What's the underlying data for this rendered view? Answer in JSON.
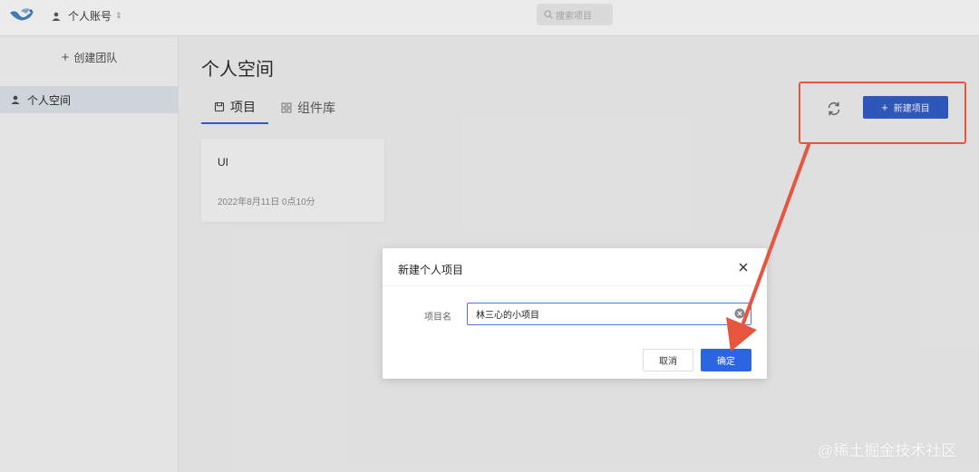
{
  "topbar": {
    "logo_icon": "bird-logo-icon",
    "account_label": "个人账号",
    "search_placeholder": "搜索项目"
  },
  "sidebar": {
    "create_team_label": "创建团队",
    "items": [
      {
        "label": "个人空间",
        "icon": "person-icon"
      }
    ]
  },
  "main": {
    "title": "个人空间",
    "tabs": [
      {
        "label": "项目",
        "icon": "save-icon",
        "active": true
      },
      {
        "label": "组件库",
        "icon": "grid-icon",
        "active": false
      }
    ],
    "projects": [
      {
        "name": "UI",
        "time": "2022年8月11日 0点10分"
      }
    ],
    "new_project_label": "新建项目"
  },
  "modal": {
    "title": "新建个人项目",
    "field_label": "项目名",
    "field_value": "林三心的小项目",
    "cancel_label": "取消",
    "ok_label": "确定"
  },
  "annotation": {
    "color": "#e8553f"
  },
  "watermark": "@稀土掘金技术社区",
  "colors": {
    "primary": "#2957c7",
    "ok_button": "#2b66e0"
  }
}
